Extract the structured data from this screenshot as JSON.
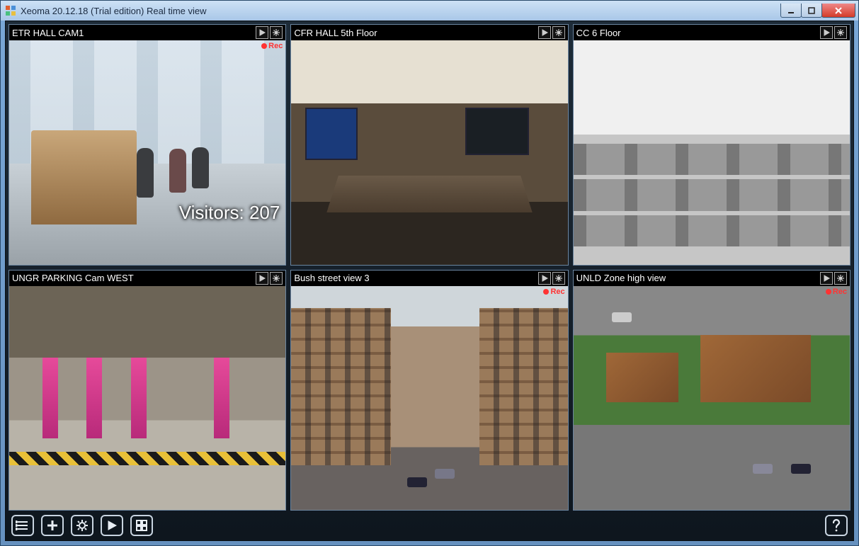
{
  "window": {
    "title": "Xeoma 20.12.18 (Trial edition) Real time view"
  },
  "rec_label": "Rec",
  "cameras": [
    {
      "name": "ETR HALL CAM1",
      "recording": true,
      "overlay": "Visitors: 207"
    },
    {
      "name": "CFR HALL 5th Floor",
      "recording": false,
      "overlay": ""
    },
    {
      "name": "CC 6 Floor",
      "recording": false,
      "overlay": ""
    },
    {
      "name": "UNGR PARKING Cam WEST",
      "recording": false,
      "overlay": ""
    },
    {
      "name": "Bush street view 3",
      "recording": true,
      "overlay": ""
    },
    {
      "name": "UNLD Zone high view",
      "recording": true,
      "overlay": ""
    }
  ],
  "toolbar": {
    "items": [
      "list",
      "add",
      "settings",
      "play",
      "layout"
    ],
    "help": "help"
  }
}
